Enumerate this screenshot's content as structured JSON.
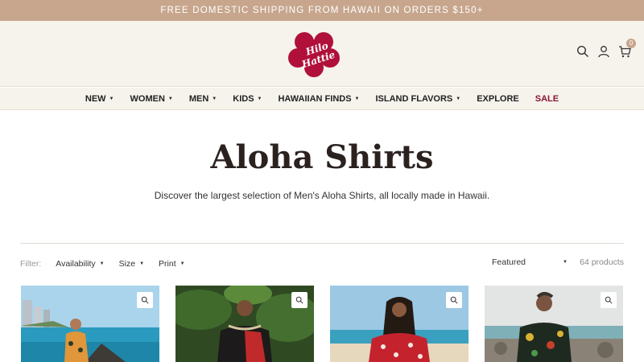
{
  "announcement": "FREE DOMESTIC SHIPPING FROM HAWAII ON ORDERS $150+",
  "brand": {
    "logo_text_1": "Hilo",
    "logo_text_2": "Hattie",
    "logo_color": "#b0103a"
  },
  "header": {
    "cart_count": "0"
  },
  "nav": [
    {
      "label": "NEW",
      "has_dropdown": true
    },
    {
      "label": "WOMEN",
      "has_dropdown": true
    },
    {
      "label": "MEN",
      "has_dropdown": true
    },
    {
      "label": "KIDS",
      "has_dropdown": true
    },
    {
      "label": "HAWAIIAN FINDS",
      "has_dropdown": true
    },
    {
      "label": "ISLAND FLAVORS",
      "has_dropdown": true
    },
    {
      "label": "EXPLORE",
      "has_dropdown": false
    },
    {
      "label": "SALE",
      "has_dropdown": false
    }
  ],
  "collection": {
    "title": "Aloha Shirts",
    "description": "Discover the largest selection of Men's Aloha Shirts, all locally made in Hawaii."
  },
  "filters": {
    "label": "Filter:",
    "items": [
      "Availability",
      "Size",
      "Print"
    ],
    "sort_selected": "Featured",
    "product_count": "64 products"
  },
  "colors": {
    "announce_bg": "#c7a68d",
    "header_bg": "#f5f3ec",
    "sale": "#8a1535"
  }
}
